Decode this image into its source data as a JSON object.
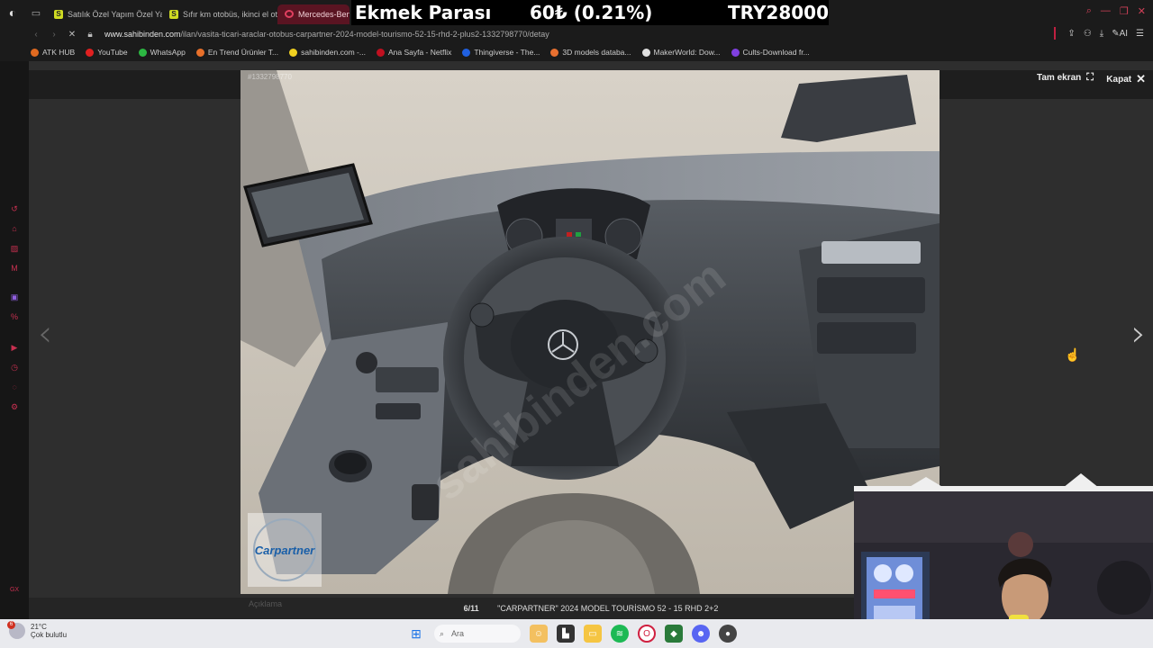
{
  "browser": {
    "tabs": [
      {
        "label": "Satılık Özel Yapım Özel Yap",
        "active": false
      },
      {
        "label": "Sıfır km otobüs, ikinci el ot",
        "active": false
      },
      {
        "label": "Mercedes-Benz",
        "active": true
      }
    ],
    "ticker": {
      "label": "Ekmek Parası",
      "change": "60₺ (0.21%)",
      "total": "TRY28000"
    },
    "url_host": "www.sahibinden.com",
    "url_path": "/ilan/vasita-ticari-araclar-otobus-carpartner-2024-model-tourismo-52-15-rhd-2-plus2-1332798770/detay",
    "bookmarks": [
      {
        "label": "ATK HUB",
        "color": "#e06a20"
      },
      {
        "label": "YouTube",
        "color": "#e02020"
      },
      {
        "label": "WhatsApp",
        "color": "#2cb742"
      },
      {
        "label": "En Trend Ürünler T...",
        "color": "#e8702a"
      },
      {
        "label": "sahibinden.com -...",
        "color": "#f0d020"
      },
      {
        "label": "Ana Sayfa - Netflix",
        "color": "#c01020"
      },
      {
        "label": "Thingiverse - The...",
        "color": "#2060e0"
      },
      {
        "label": "3D models databa...",
        "color": "#e87030"
      },
      {
        "label": "MakerWorld: Dow...",
        "color": "#e0e0e0"
      },
      {
        "label": "Cults-Download fr...",
        "color": "#8040e0"
      }
    ]
  },
  "gallery": {
    "fullscreen_label": "Tam ekran",
    "close_label": "Kapat",
    "image_id": "#1332798770",
    "index": "6/11",
    "title": "\"CARPARTNER\" 2024 MODEL TOURİSMO 52 - 15 RHD 2+2",
    "description_label": "Açıklama",
    "watermark": "sahibinden.com",
    "logo_text": "Carpartner"
  },
  "taskbar": {
    "weather_temp": "21°C",
    "weather_desc": "Çok bulutlu",
    "weather_badge": "6",
    "search_placeholder": "Ara"
  }
}
